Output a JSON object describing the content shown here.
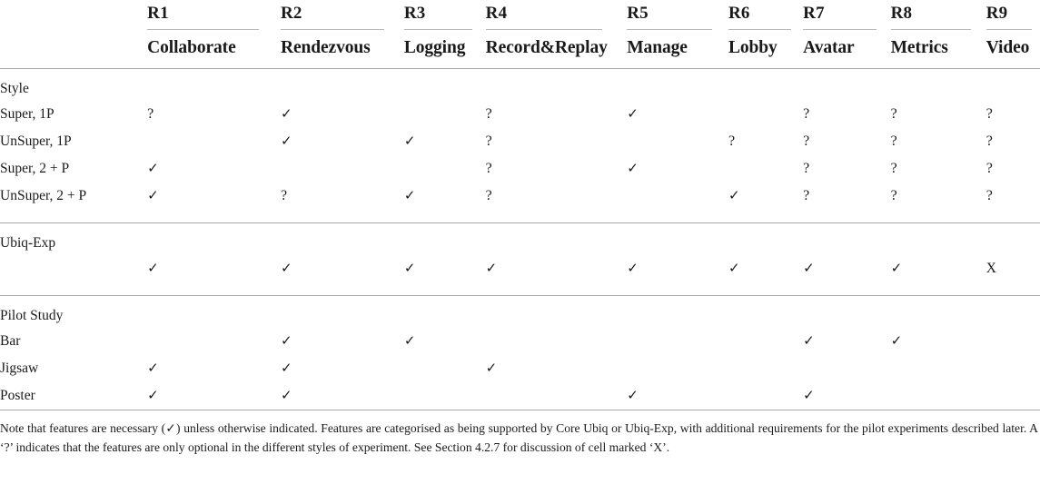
{
  "table": {
    "columns": [
      {
        "code": "R1",
        "name": "Collaborate"
      },
      {
        "code": "R2",
        "name": "Rendezvous"
      },
      {
        "code": "R3",
        "name": "Logging"
      },
      {
        "code": "R4",
        "name": "Record&Replay"
      },
      {
        "code": "R5",
        "name": "Manage"
      },
      {
        "code": "R6",
        "name": "Lobby"
      },
      {
        "code": "R7",
        "name": "Avatar"
      },
      {
        "code": "R8",
        "name": "Metrics"
      },
      {
        "code": "R9",
        "name": "Video"
      }
    ],
    "sections": [
      {
        "title": "Style",
        "rows": [
          {
            "label": "Super, 1P",
            "marks": [
              "?",
              "✓",
              "",
              "?",
              "✓",
              "",
              "?",
              "?",
              "?"
            ]
          },
          {
            "label": "UnSuper, 1P",
            "marks": [
              "",
              "✓",
              "✓",
              "?",
              "",
              "?",
              "?",
              "?",
              "?"
            ]
          },
          {
            "label": "Super, 2 + P",
            "marks": [
              "✓",
              "",
              "",
              "?",
              "✓",
              "",
              "?",
              "?",
              "?"
            ]
          },
          {
            "label": "UnSuper, 2 + P",
            "marks": [
              "✓",
              "?",
              "✓",
              "?",
              "",
              "✓",
              "?",
              "?",
              "?"
            ]
          }
        ]
      },
      {
        "title": "Ubiq-Exp",
        "rows": [
          {
            "label": "",
            "marks": [
              "✓",
              "✓",
              "✓",
              "✓",
              "✓",
              "✓",
              "✓",
              "✓",
              "X"
            ]
          }
        ]
      },
      {
        "title": "Pilot Study",
        "rows": [
          {
            "label": "Bar",
            "marks": [
              "",
              "✓",
              "✓",
              "",
              "",
              "",
              "✓",
              "✓",
              ""
            ]
          },
          {
            "label": "Jigsaw",
            "marks": [
              "✓",
              "✓",
              "",
              "✓",
              "",
              "",
              "",
              "",
              ""
            ]
          },
          {
            "label": "Poster",
            "marks": [
              "✓",
              "✓",
              "",
              "",
              "✓",
              "",
              "✓",
              "",
              ""
            ]
          }
        ]
      }
    ]
  },
  "footnote": {
    "text": "Note that features are necessary (✓) unless otherwise indicated. Features are categorised as being supported by Core Ubiq or Ubiq-Exp, with additional requirements for the pilot experiments described later. A ‘?’ indicates that the features are only optional in the different styles of experiment. See Section 4.2.7 for discussion of cell marked ‘X’."
  }
}
